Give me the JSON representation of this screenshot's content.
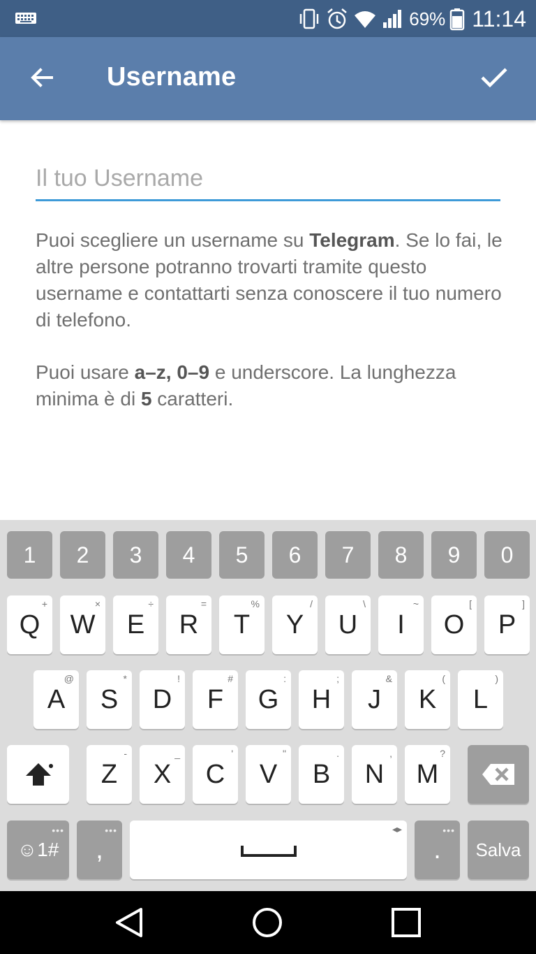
{
  "status_bar": {
    "battery_percent": "69%",
    "time": "11:14",
    "icons": [
      "keyboard-icon",
      "vibrate-icon",
      "alarm-icon",
      "wifi-icon",
      "signal-icon",
      "battery-icon"
    ]
  },
  "app_bar": {
    "title": "Username",
    "back_icon": "arrow-back-icon",
    "done_icon": "check-icon"
  },
  "username_field": {
    "value": "",
    "placeholder": "Il tuo Username"
  },
  "info": {
    "p1_a": "Puoi scegliere un username su ",
    "p1_bold": "Telegram",
    "p1_b": ". Se lo fai, le altre persone potranno trovarti tramite questo username e contattarti senza conoscere il tuo numero di telefono.",
    "p2_a": "Puoi usare ",
    "p2_bold1": "a–z, 0–9",
    "p2_b": " e underscore. La lunghezza minima è di ",
    "p2_bold2": "5",
    "p2_c": " caratteri."
  },
  "keyboard": {
    "numbers": [
      "1",
      "2",
      "3",
      "4",
      "5",
      "6",
      "7",
      "8",
      "9",
      "0"
    ],
    "row1": [
      {
        "key": "Q",
        "hint": "+"
      },
      {
        "key": "W",
        "hint": "×"
      },
      {
        "key": "E",
        "hint": "÷"
      },
      {
        "key": "R",
        "hint": "="
      },
      {
        "key": "T",
        "hint": "%"
      },
      {
        "key": "Y",
        "hint": "/"
      },
      {
        "key": "U",
        "hint": "\\"
      },
      {
        "key": "I",
        "hint": "~"
      },
      {
        "key": "O",
        "hint": "["
      },
      {
        "key": "P",
        "hint": "]"
      }
    ],
    "row2": [
      {
        "key": "A",
        "hint": "@"
      },
      {
        "key": "S",
        "hint": "*"
      },
      {
        "key": "D",
        "hint": "!"
      },
      {
        "key": "F",
        "hint": "#"
      },
      {
        "key": "G",
        "hint": ":"
      },
      {
        "key": "H",
        "hint": ";"
      },
      {
        "key": "J",
        "hint": "&"
      },
      {
        "key": "K",
        "hint": "("
      },
      {
        "key": "L",
        "hint": ")"
      }
    ],
    "row3": [
      {
        "key": "Z",
        "hint": "-"
      },
      {
        "key": "X",
        "hint": "_"
      },
      {
        "key": "C",
        "hint": "'"
      },
      {
        "key": "V",
        "hint": "\""
      },
      {
        "key": "B",
        "hint": "."
      },
      {
        "key": "N",
        "hint": ","
      },
      {
        "key": "M",
        "hint": "?"
      }
    ],
    "symbols_key": "☺1#",
    "comma_key": ",",
    "period_key": ".",
    "action_key": "Salva"
  },
  "nav_bar": {
    "icons": [
      "nav-back-icon",
      "nav-home-icon",
      "nav-recents-icon"
    ]
  }
}
